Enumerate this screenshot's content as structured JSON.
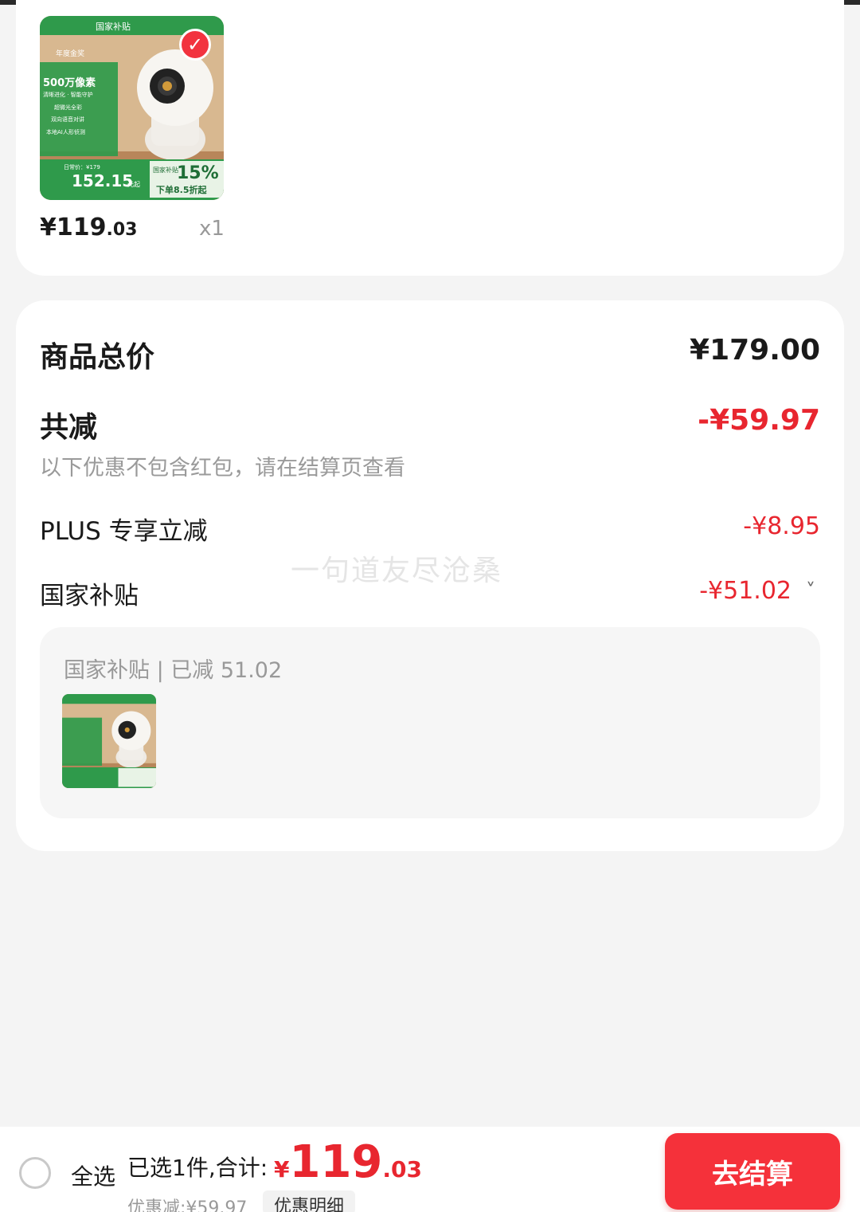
{
  "product": {
    "price_int": "¥119",
    "price_dec": ".03",
    "quantity": "x1",
    "thumb_texts": {
      "top_tag": "国家补贴",
      "award": "年度金奖",
      "pixels": "500万像素",
      "feature1": "清晰进化 · 智能守护",
      "feature2": "超微光全彩",
      "feature3": "双向语音对讲",
      "feature4": "本地AI人形侦测",
      "daily_price": "日常价：¥179",
      "sub_price": "152.15",
      "sub_unit": "元起",
      "nat_sub": "国家补贴",
      "percent": "15%",
      "discount": "下单8.5折起"
    }
  },
  "summary": {
    "total_label": "商品总价",
    "total_value": "¥179.00",
    "reduce_label": "共减",
    "reduce_value": "-¥59.97",
    "reduce_note": "以下优惠不包含红包，请在结算页查看",
    "plus_label": "PLUS 专享立减",
    "plus_value": "-¥8.95",
    "subsidy_label": "国家补贴",
    "subsidy_value": "-¥51.02",
    "watermark": "一句道友尽沧桑",
    "subsidy_box_title": "国家补贴 | 已减 51.02"
  },
  "bottom": {
    "select_all": "全选",
    "selected_text": "已选1件,合计:",
    "yen": "¥",
    "grand_int": "119",
    "grand_dec": ".03",
    "discount_text": "优惠减:¥59.97",
    "detail_chip": "优惠明细",
    "checkout": "去结算"
  },
  "colors": {
    "accent_red": "#e8262f",
    "button_red": "#f5313a",
    "thumb_green": "#2f9a4b"
  }
}
